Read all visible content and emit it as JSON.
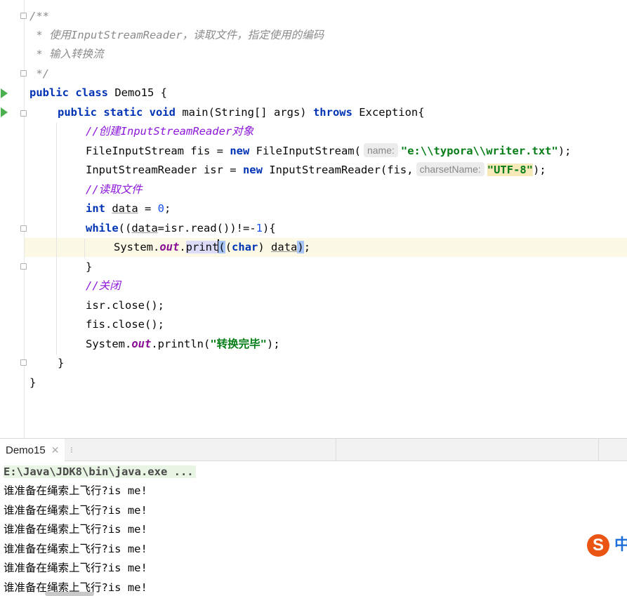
{
  "editor": {
    "lines": [
      "/**",
      " * 使用InputStreamReader，读取文件，指定使用的编码",
      " * 输入转换流",
      " */",
      "public class Demo15 {",
      "public static void main(String[] args) throws Exception{",
      "//创建InputStreamReader对象",
      "FileInputStream fis = new FileInputStream(",
      "InputStreamReader isr = new InputStreamReader(fis,",
      "//读取文件",
      "int data = 0;",
      "while((data=isr.read())!=-1){",
      "System.out.print((char) data);",
      "}",
      "//关闭",
      "isr.close();",
      "fis.close();",
      "System.out.println(\"转换完毕\");",
      "}",
      "}"
    ],
    "hint_name": "name:",
    "hint_charset": "charsetName:",
    "path_string": "\"e:\\\\typora\\\\writer.txt\"",
    "charset_string": "\"UTF-8\"",
    "done_string": "\"转换完毕\""
  },
  "console": {
    "tab_label": "Demo15",
    "command": "E:\\Java\\JDK8\\bin\\java.exe ...",
    "output_lines": [
      "谁准备在绳索上飞行?is me!",
      "谁准备在绳索上飞行?is me!",
      "谁准备在绳索上飞行?is me!",
      "谁准备在绳索上飞行?is me!",
      "谁准备在绳索上飞行?is me!",
      "谁准备在绳索上飞行?is me!"
    ]
  },
  "ime": {
    "logo_letter": "S",
    "mode": "中"
  },
  "colors": {
    "keyword": "#0033b3",
    "string": "#067d17",
    "line_comment": "#8c17d9",
    "run_icon": "#4caf50"
  }
}
